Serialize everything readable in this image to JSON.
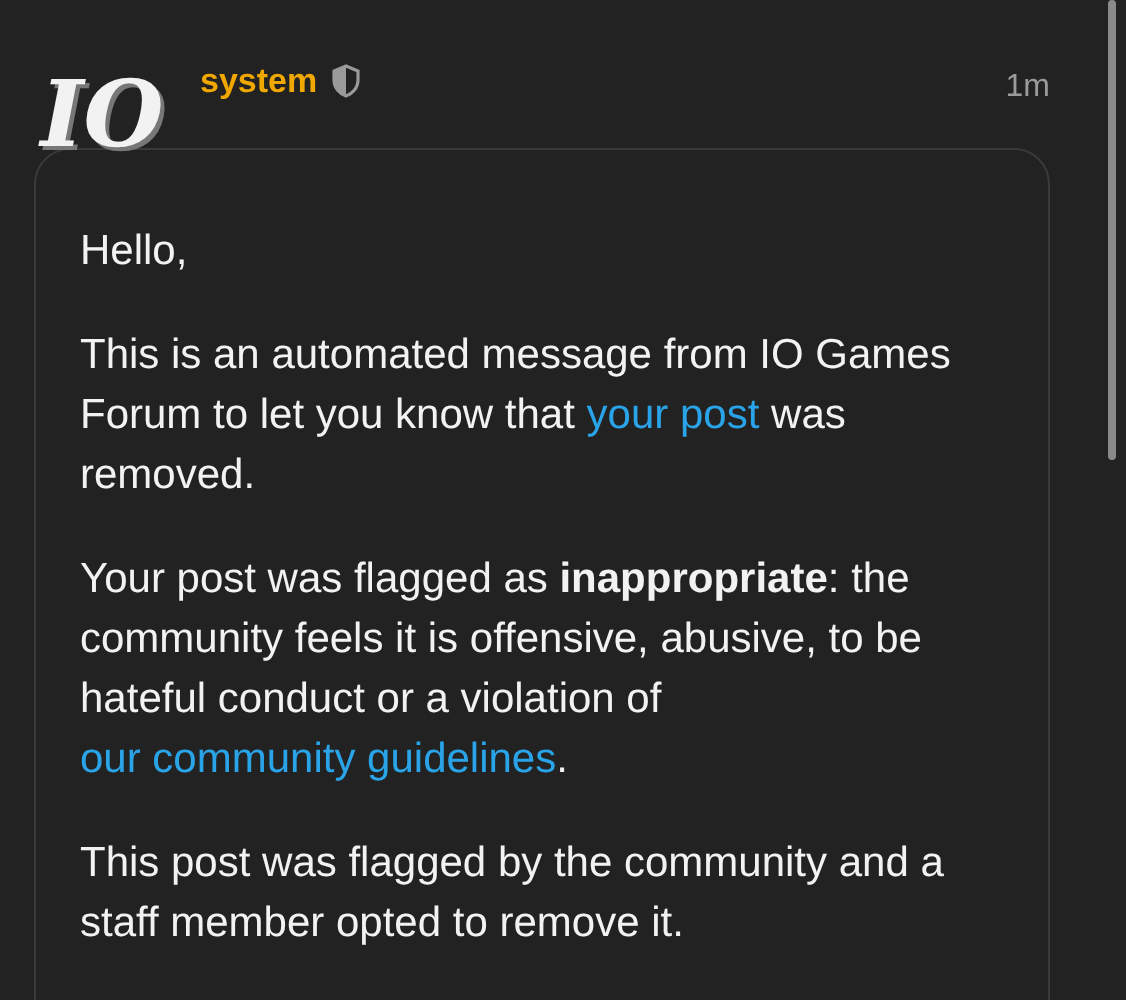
{
  "post": {
    "avatar": {
      "logo_text": "IO"
    },
    "username": "system",
    "moderator": true,
    "time": "1m",
    "paragraphs": [
      {
        "segments": [
          {
            "kind": "text",
            "text": "Hello,"
          }
        ]
      },
      {
        "segments": [
          {
            "kind": "text",
            "text": "This is an automated message from IO Games Forum to let you know that "
          },
          {
            "kind": "link",
            "text": "your post"
          },
          {
            "kind": "text",
            "text": " was removed."
          }
        ]
      },
      {
        "segments": [
          {
            "kind": "text",
            "text": "Your post was flagged as **inappropriate**: the community feels it is offensive, abusive, to be hateful conduct or a violation of "
          },
          {
            "kind": "link",
            "text": "our community guidelines"
          },
          {
            "kind": "text",
            "text": "."
          }
        ]
      },
      {
        "segments": [
          {
            "kind": "text",
            "text": "This post was flagged by the community and a staff member opted to remove it."
          }
        ]
      }
    ]
  }
}
